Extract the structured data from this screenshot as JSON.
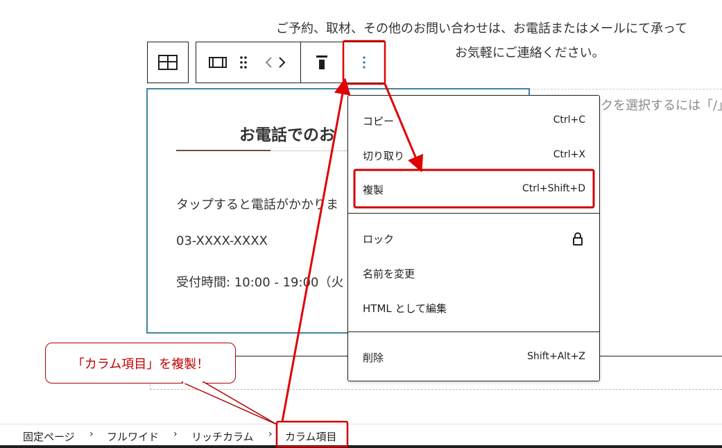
{
  "content": {
    "intro_line1": "ご予約、取材、その他のお問い合わせは、お電話またはメールにて承って",
    "intro_line2": "お気軽にご連絡ください。",
    "placeholder_text": "クを選択するには「/」"
  },
  "toolbar": {
    "parent_icon": "columns-grid-icon",
    "block_type_icon": "column-block-icon",
    "drag_icon": "drag-handle-icon",
    "move_icon": "move-left-right-icon",
    "align_icon": "vertical-align-top-icon",
    "options_icon": "more-vertical-icon"
  },
  "column": {
    "title": "お電話でのお",
    "text1": "タップすると電話がかかりま",
    "text2": "03-XXXX-XXXX",
    "text3": "受付時間: 10:00 - 19:00（火"
  },
  "menu": {
    "items": [
      {
        "label": "コピー",
        "shortcut": "Ctrl+C"
      },
      {
        "label": "切り取り",
        "shortcut": "Ctrl+X"
      },
      {
        "label": "複製",
        "shortcut": "Ctrl+Shift+D"
      },
      {
        "label": "ロック",
        "icon": "lock-icon"
      },
      {
        "label": "名前を変更"
      },
      {
        "label": "HTML として編集"
      },
      {
        "label": "削除",
        "shortcut": "Shift+Alt+Z"
      }
    ]
  },
  "callout": {
    "text": "「カラム項目」を複製！"
  },
  "breadcrumb": {
    "items": [
      "固定ページ",
      "フルワイド",
      "リッチカラム",
      "カラム項目"
    ]
  },
  "colors": {
    "annotation_red": "#e00000",
    "block_outline": "#3f84a6",
    "accent_line": "#6d4b3a",
    "options_icon": "#3f84a6"
  }
}
